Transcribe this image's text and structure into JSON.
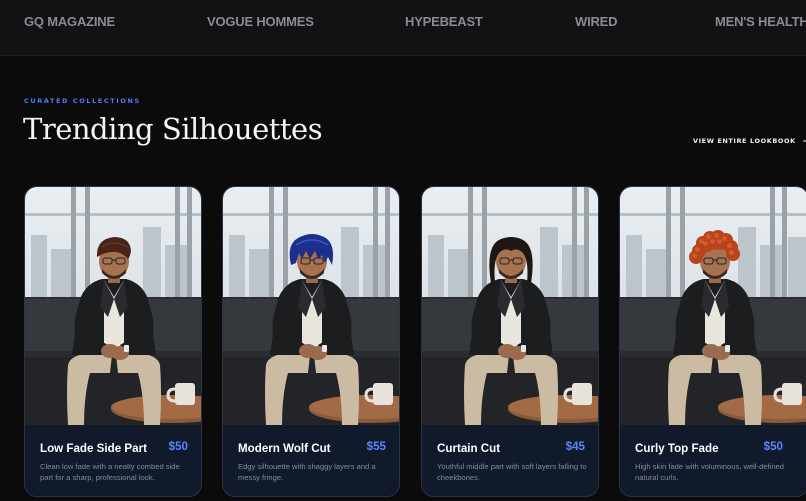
{
  "press": [
    "GQ MAGAZINE",
    "VOGUE HOMMES",
    "HYPEBEAST",
    "WIRED",
    "MEN'S HEALTH"
  ],
  "section": {
    "kicker": "CURATED COLLECTIONS",
    "title": "Trending Silhouettes",
    "view_all": "VIEW ENTIRE LOOKBOOK"
  },
  "cards": [
    {
      "name": "Low Fade Side Part",
      "price": "$50",
      "description": "Clean low fade with a neatly combed side part for a sharp, professional look.",
      "hair_style": "side-part",
      "hair_color": "#4a2418"
    },
    {
      "name": "Modern Wolf Cut",
      "price": "$55",
      "description": "Edgy silhouette with shaggy layers and a messy fringe.",
      "hair_style": "wolf-cut",
      "hair_color": "#1c2f8a"
    },
    {
      "name": "Curtain Cut",
      "price": "$45",
      "description": "Youthful middle part with soft layers falling to cheekbones.",
      "hair_style": "curtain",
      "hair_color": "#1e1712"
    },
    {
      "name": "Curly Top Fade",
      "price": "$50",
      "description": "High skin fade with voluminous, well-defined natural curls.",
      "hair_style": "curly",
      "hair_color": "#b8441c"
    }
  ],
  "colors": {
    "background": "#0b0b0c",
    "accent": "#4f7bf7",
    "price": "#5a85ff",
    "card_body": "#101a2b"
  },
  "icons": {
    "view_all": "arrow-right-icon"
  }
}
